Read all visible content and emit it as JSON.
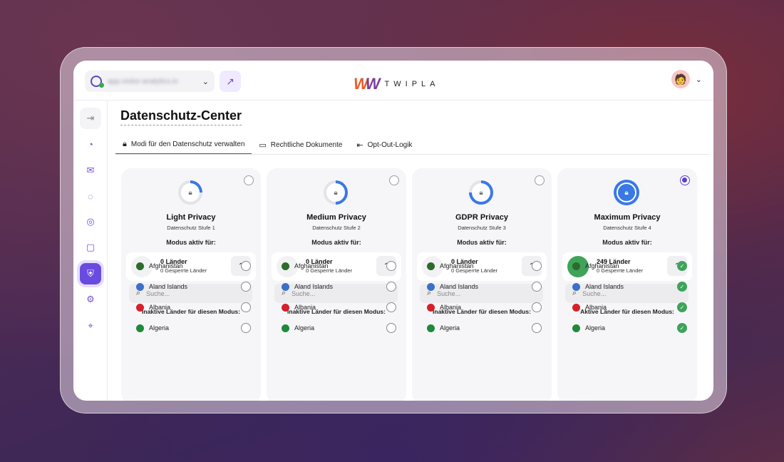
{
  "header": {
    "site_url": "app.visitor-analytics.io",
    "logo_text": "TWIPLA"
  },
  "page": {
    "title": "Datenschutz-Center"
  },
  "tabs": [
    {
      "label": "Modi für den Datenschutz verwalten",
      "icon": "lock-icon",
      "active": true
    },
    {
      "label": "Rechtliche Dokumente",
      "icon": "folder-icon",
      "active": false
    },
    {
      "label": "Opt-Out-Logik",
      "icon": "logout-icon",
      "active": false
    }
  ],
  "sidebar": {
    "items": [
      "expand-icon",
      "dashboard-icon",
      "inbox-icon",
      "analytics-icon",
      "recording-icon",
      "chat-icon",
      "privacy-shield-icon",
      "settings-icon",
      "location-icon"
    ],
    "active_index": 6
  },
  "cards": [
    {
      "name": "Light Privacy",
      "level": "Datenschutz Stufe 1",
      "mode_label": "Modus aktiv für:",
      "count": "0 Länder",
      "blocked": "0 Gesperrte Länder",
      "search_placeholder": "Suche...",
      "list_heading": "Inaktive Länder für diesen Modus:",
      "selected": false,
      "progress": 0.25
    },
    {
      "name": "Medium Privacy",
      "level": "Datenschutz Stufe 2",
      "mode_label": "Modus aktiv für:",
      "count": "0 Länder",
      "blocked": "0 Gesperrte Länder",
      "search_placeholder": "Suche...",
      "list_heading": "Inaktive Länder für diesen Modus:",
      "selected": false,
      "progress": 0.5
    },
    {
      "name": "GDPR Privacy",
      "level": "Datenschutz Stufe 3",
      "mode_label": "Modus aktiv für:",
      "count": "0 Länder",
      "blocked": "0 Gesperrte Länder",
      "search_placeholder": "Suche...",
      "list_heading": "Inaktive Länder für diesen Modus:",
      "selected": false,
      "progress": 0.75
    },
    {
      "name": "Maximum Privacy",
      "level": "Datenschutz Stufe 4",
      "mode_label": "Modus aktiv für:",
      "count": "249 Länder",
      "blocked": "0 Gesperrte Länder",
      "search_placeholder": "Suche...",
      "list_heading": "Aktive Länder für diesen Modus:",
      "selected": true,
      "progress": 1.0
    }
  ],
  "countries": [
    {
      "name": "Afghanistan",
      "flag_color": "#2b6b2b"
    },
    {
      "name": "Aland Islands",
      "flag_color": "#3b6fc9"
    },
    {
      "name": "Albania",
      "flag_color": "#d6202a"
    },
    {
      "name": "Algeria",
      "flag_color": "#1f8a3a"
    }
  ],
  "colors": {
    "accent": "#6a4be0",
    "blue": "#3a78e6",
    "green": "#3fa35a"
  }
}
